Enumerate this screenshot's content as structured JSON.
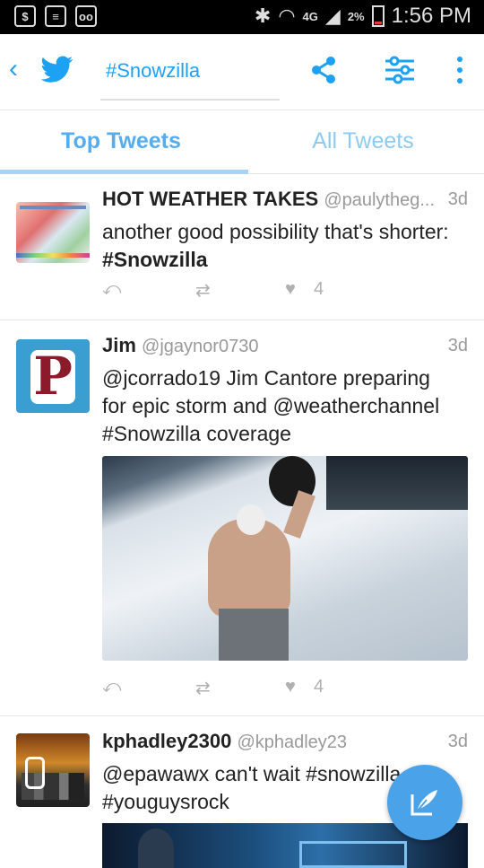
{
  "status": {
    "signal": "4G",
    "battery": "2%",
    "time": "1:56 PM"
  },
  "search": {
    "query": "#Snowzilla"
  },
  "tabs": [
    "Top Tweets",
    "All Tweets"
  ],
  "tweets": [
    {
      "name": "HOT WEATHER TAKES",
      "handle": "@paulytheg...",
      "time": "3d",
      "text_lines": [
        "another good possibility that's shorter:",
        "#Snowzilla"
      ],
      "likes": "4"
    },
    {
      "name": "Jim",
      "handle": "@jgaynor0730",
      "time": "3d",
      "text_lines": [
        "@jcorrado19 Jim Cantore preparing",
        "for epic storm and @weatherchannel",
        "#Snowzilla coverage"
      ],
      "likes": "4"
    },
    {
      "name": "kphadley2300",
      "handle": "@kphadley23",
      "time": "3d",
      "text_lines": [
        "@epawawx can't wait #snowzilla",
        "#youguysrock"
      ],
      "likes": ""
    }
  ],
  "colors": {
    "accent": "#1da1f2",
    "fab": "#4aa3e8"
  },
  "icons": [
    "back-icon",
    "twitter-bird-icon",
    "share-icon",
    "filter-icon",
    "more-icon",
    "reply-icon",
    "retweet-icon",
    "like-icon",
    "compose-icon"
  ]
}
